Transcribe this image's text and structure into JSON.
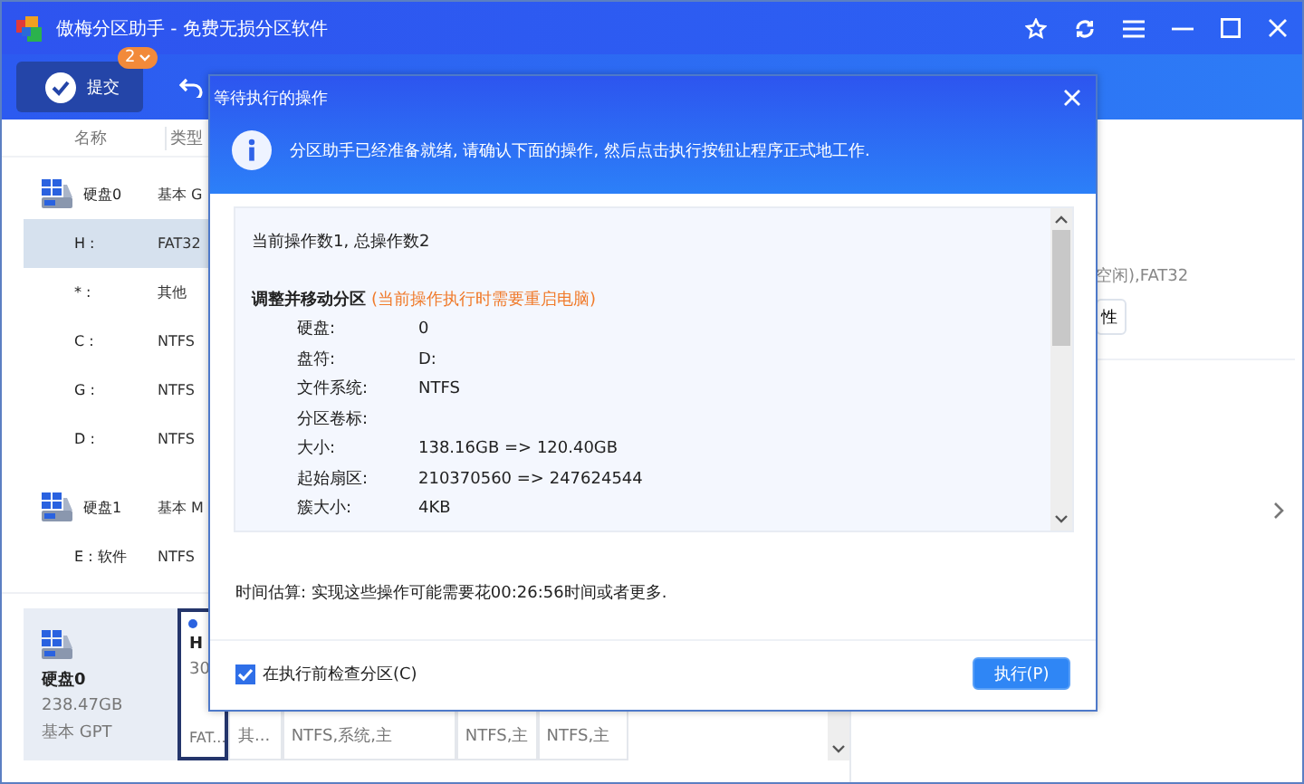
{
  "window": {
    "title": "傲梅分区助手 - 免费无损分区软件"
  },
  "toolbar": {
    "commit_button": "提交",
    "pending_badge": "2"
  },
  "disk_list": {
    "columns": [
      "名称",
      "类型"
    ],
    "rows": [
      {
        "kind": "disk",
        "name": "硬盘0",
        "type": "基本 G",
        "selected": false
      },
      {
        "kind": "partition",
        "name": "H :",
        "type": "FAT32",
        "selected": true
      },
      {
        "kind": "partition",
        "name": "* :",
        "type": "其他",
        "selected": false
      },
      {
        "kind": "partition",
        "name": "C :",
        "type": "NTFS",
        "selected": false
      },
      {
        "kind": "partition",
        "name": "G :",
        "type": "NTFS",
        "selected": false
      },
      {
        "kind": "partition",
        "name": "D :",
        "type": "NTFS",
        "selected": false
      },
      {
        "kind": "disk",
        "name": "硬盘1",
        "type": "基本 M",
        "selected": false
      },
      {
        "kind": "partition",
        "name": "E : 软件",
        "type": "NTFS",
        "selected": false
      }
    ]
  },
  "disk_map": {
    "disk": {
      "name": "硬盘0",
      "size": "238.47GB",
      "style": "基本 GPT"
    },
    "partitions": [
      {
        "name": "H",
        "size": "30",
        "info": "FAT...",
        "selected": true
      },
      {
        "info": "其...",
        "selected": false
      },
      {
        "info": "NTFS,系统,主",
        "selected": false
      },
      {
        "info": "NTFS,主",
        "selected": false
      },
      {
        "info": "NTFS,主",
        "selected": false
      }
    ]
  },
  "right_panel": {
    "info": "空闲),FAT32",
    "button": "性"
  },
  "dialog": {
    "title": "等待执行的操作",
    "notice": "分区助手已经准备就绪, 请确认下面的操作, 然后点击执行按钮让程序正式地工作.",
    "summary": "当前操作数1, 总操作数2",
    "operation": {
      "title": "调整并移动分区",
      "warning": "(当前操作执行时需要重启电脑)",
      "details": [
        {
          "label": "硬盘:",
          "value": "0"
        },
        {
          "label": "盘符:",
          "value": "D:"
        },
        {
          "label": "文件系统:",
          "value": "NTFS"
        },
        {
          "label": "分区卷标:"
        },
        {
          "label": "大小:",
          "value": "138.16GB => 120.40GB"
        },
        {
          "label": "起始扇区:",
          "value": "210370560 => 247624544"
        },
        {
          "label": "簇大小:",
          "value": "4KB"
        }
      ]
    },
    "estimate": "时间估算: 实现这些操作可能需要花00:26:56时间或者更多.",
    "check": {
      "label": "在执行前检查分区(C)",
      "checked": true
    },
    "execute_button": "执行(P)"
  }
}
